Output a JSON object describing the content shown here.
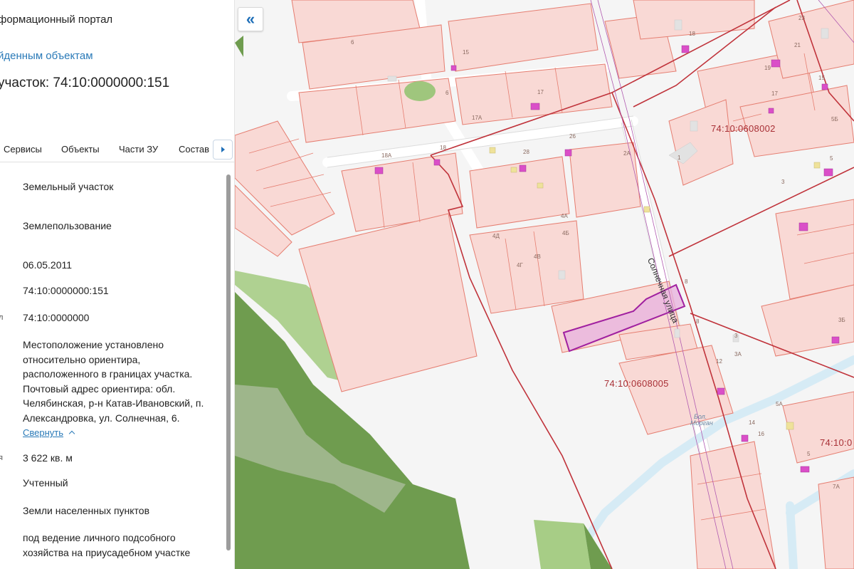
{
  "panel": {
    "portal_title": "формационный портал",
    "back_link": "йденным объектам",
    "parcel_title": "участок: 74:10:0000000:151",
    "tabs": [
      "Сервисы",
      "Объекты",
      "Части ЗУ",
      "Состав"
    ],
    "properties": [
      {
        "label": "",
        "value": "Земельный участок"
      },
      {
        "label": "",
        "value": "Землепользование"
      },
      {
        "label": "",
        "value": "06.05.2011"
      },
      {
        "label": "",
        "value": "74:10:0000000:151"
      },
      {
        "label": "л",
        "value": "74:10:0000000"
      },
      {
        "label": "",
        "value": "Местоположение установлено относительно ориентира, расположенного в границах участка. Почтовый адрес ориентира: обл. Челябинская, р-н Катав-Ивановский, п. Александровка, ул. Солнечная, 6."
      },
      {
        "label": "я",
        "value": "3 622 кв. м"
      },
      {
        "label": "",
        "value": "Учтенный"
      },
      {
        "label": "",
        "value": "Земли населенных пунктов"
      },
      {
        "label": "",
        "value": "под ведение личного подсобного хозяйства на приусадебном участке"
      }
    ],
    "collapse_label": "Свернуть"
  },
  "map": {
    "collapse_button": "«",
    "street_name": "Солнечная улица",
    "river_name_line1": "Бол.",
    "river_name_line2": "Морган",
    "quarter_labels": [
      "74:10:0608002",
      "74:10:0608005",
      "74:10:0"
    ],
    "colors": {
      "parcel_fill": "#f9d9d5",
      "parcel_stroke": "#e57d70",
      "quarter_line": "#c0333b",
      "selected_fill": "#e8b4de",
      "selected_stroke": "#a020a0",
      "forest_dark": "#6f9c4f",
      "forest_light": "#a7cd86",
      "water": "#d6ebf5",
      "building": "#da4fc8"
    }
  }
}
